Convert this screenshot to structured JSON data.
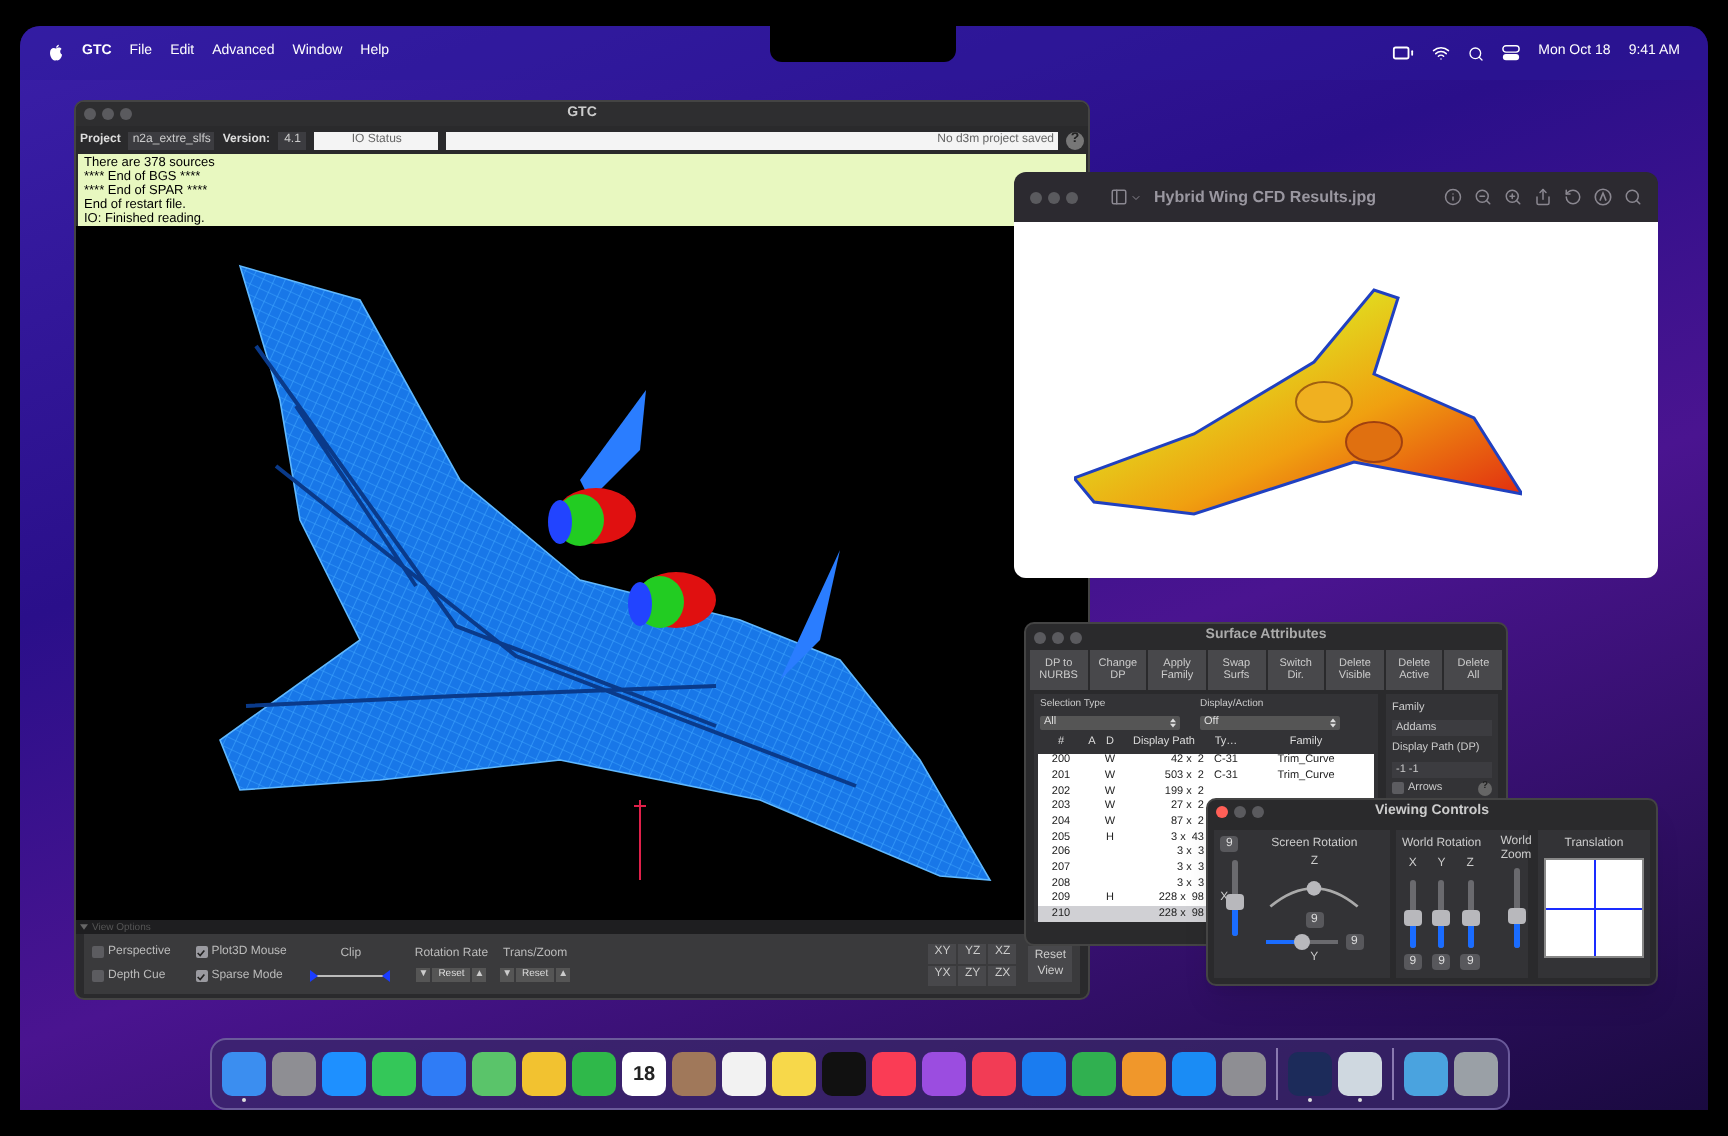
{
  "menu_bar": {
    "app": "GTC",
    "items": [
      "File",
      "Edit",
      "Advanced",
      "Window",
      "Help"
    ],
    "date": "Mon Oct 18",
    "time": "9:41 AM"
  },
  "gtc_window": {
    "title": "GTC",
    "project_label": "Project",
    "project": "n2a_extre_slfs",
    "version_label": "Version:",
    "version": "4.1",
    "io_status": "IO Status",
    "message": "No d3m project saved",
    "help": "?",
    "console": [
      "There are 378 sources",
      "**** End of BGS ****",
      "**** End of SPAR ****",
      "End of restart file.",
      "IO: Finished reading."
    ],
    "view_options": "View Options",
    "options": [
      {
        "label": "Perspective",
        "checked": false
      },
      {
        "label": "Depth Cue",
        "checked": false
      },
      {
        "label": "Plot3D Mouse",
        "checked": true
      },
      {
        "label": "Sparse Mode",
        "checked": true
      }
    ],
    "clip": {
      "label": "Clip",
      "start": {
        "level": 0
      },
      "end": {
        "level": 1
      }
    },
    "steppers": [
      {
        "label": "Rotation Rate",
        "down": "▼",
        "reset": "Reset",
        "up": "▲"
      },
      {
        "label": "Trans/Zoom",
        "down": "▼",
        "reset": "Reset",
        "up": "▲"
      }
    ],
    "view_buttons": [
      "XY",
      "YZ",
      "XZ",
      "YX",
      "ZY",
      "ZX"
    ],
    "reset_view": "Reset\nView"
  },
  "preview_window": {
    "title": "Hybrid Wing CFD Results.jpg"
  },
  "surface_window": {
    "title": "Surface Attributes",
    "buttons": [
      "DP to\nNURBS",
      "Change\nDP",
      "Apply\nFamily",
      "Swap\nSurfs",
      "Switch\nDir.",
      "Delete\nVisible",
      "Delete\nActive",
      "Delete\nAll"
    ],
    "selection_type_label": "Selection Type",
    "selection_type": "All",
    "display_action_label": "Display/Action",
    "display_action": "Off",
    "columns": [
      "#",
      "A",
      "D",
      "Display Path",
      "Ty…",
      "Family"
    ],
    "rows": [
      {
        "num": "200",
        "d": "W",
        "path": "42 x  2",
        "type": "C-31",
        "family": "Trim_Curve",
        "selected": false
      },
      {
        "num": "201",
        "d": "W",
        "path": "503 x  2",
        "type": "C-31",
        "family": "Trim_Curve",
        "selected": false
      },
      {
        "num": "202",
        "d": "W",
        "path": "199 x  2",
        "selected": false
      },
      {
        "num": "203",
        "d": "W",
        "path": "27 x  2",
        "selected": false
      },
      {
        "num": "204",
        "d": "W",
        "path": "87 x  2",
        "selected": false
      },
      {
        "num": "205",
        "d": "H",
        "path": "3 x  43",
        "selected": false
      },
      {
        "num": "206",
        "path": "3 x  3",
        "selected": false
      },
      {
        "num": "207",
        "path": "3 x  3",
        "selected": false
      },
      {
        "num": "208",
        "path": "3 x  3",
        "selected": false
      },
      {
        "num": "209",
        "d": "H",
        "path": "228 x  98",
        "selected": false
      },
      {
        "num": "210",
        "path": "228 x  98",
        "selected": true
      }
    ],
    "family_label": "Family",
    "family": "Addams",
    "dp_label": "Display Path (DP)",
    "dp": "-1 -1",
    "arrows": {
      "label": "Arrows",
      "checked": false
    },
    "help": "?"
  },
  "viewing_controls": {
    "title": "Viewing Controls",
    "screen_rotation_label": "Screen Rotation",
    "screen_value": "9",
    "x_slider": {
      "label": "X",
      "level": 0.45
    },
    "z_slider": {
      "label": "Z",
      "level": 0.5,
      "value": "9"
    },
    "y_slider": {
      "label": "Y",
      "level": 0.5,
      "value": "9"
    },
    "world_rotation_label": "World Rotation",
    "zoom_slider": {
      "label": "World\nZoom",
      "level": 0.4
    },
    "world_sliders": [
      {
        "label": "X",
        "level": 0.45,
        "value": "9"
      },
      {
        "label": "Y",
        "level": 0.45,
        "value": "9"
      },
      {
        "label": "Z",
        "level": 0.45,
        "value": "9"
      }
    ],
    "translation_label": "Translation"
  },
  "dock": [
    {
      "kind": "app",
      "color": "#3b8ef0",
      "running": true
    },
    {
      "kind": "app",
      "color": "#8e8e93",
      "running": false
    },
    {
      "kind": "app",
      "color": "#1e90ff",
      "running": false
    },
    {
      "kind": "app",
      "color": "#34c759",
      "running": false
    },
    {
      "kind": "app",
      "color": "#2f7cf6",
      "running": false
    },
    {
      "kind": "app",
      "color": "#5ac46a",
      "running": false
    },
    {
      "kind": "app",
      "color": "#f2c230",
      "running": false
    },
    {
      "kind": "app",
      "color": "#2fb84a",
      "running": false
    },
    {
      "kind": "calendar",
      "color": "#ffffff",
      "label": "18",
      "running": false
    },
    {
      "kind": "app",
      "color": "#a0785a",
      "running": false
    },
    {
      "kind": "app",
      "color": "#f2f2f2",
      "running": false
    },
    {
      "kind": "app",
      "color": "#f7d84a",
      "running": false
    },
    {
      "kind": "app",
      "color": "#111111",
      "running": false
    },
    {
      "kind": "app",
      "color": "#fa3c55",
      "running": false
    },
    {
      "kind": "app",
      "color": "#9b4de0",
      "running": false
    },
    {
      "kind": "app",
      "color": "#f23c55",
      "running": false
    },
    {
      "kind": "app",
      "color": "#1a7cf0",
      "running": false
    },
    {
      "kind": "app",
      "color": "#30b050",
      "running": false
    },
    {
      "kind": "app",
      "color": "#f0972b",
      "running": false
    },
    {
      "kind": "app",
      "color": "#1a8cf5",
      "running": false
    },
    {
      "kind": "app",
      "color": "#8e8e93",
      "running": false
    },
    {
      "kind": "separator"
    },
    {
      "kind": "app",
      "color": "#1c2b5a",
      "running": true
    },
    {
      "kind": "app",
      "color": "#cfd8e0",
      "running": true
    },
    {
      "kind": "separator"
    },
    {
      "kind": "app",
      "color": "#4aa3df",
      "running": false
    },
    {
      "kind": "app",
      "color": "#9aa0a6",
      "running": false
    }
  ]
}
